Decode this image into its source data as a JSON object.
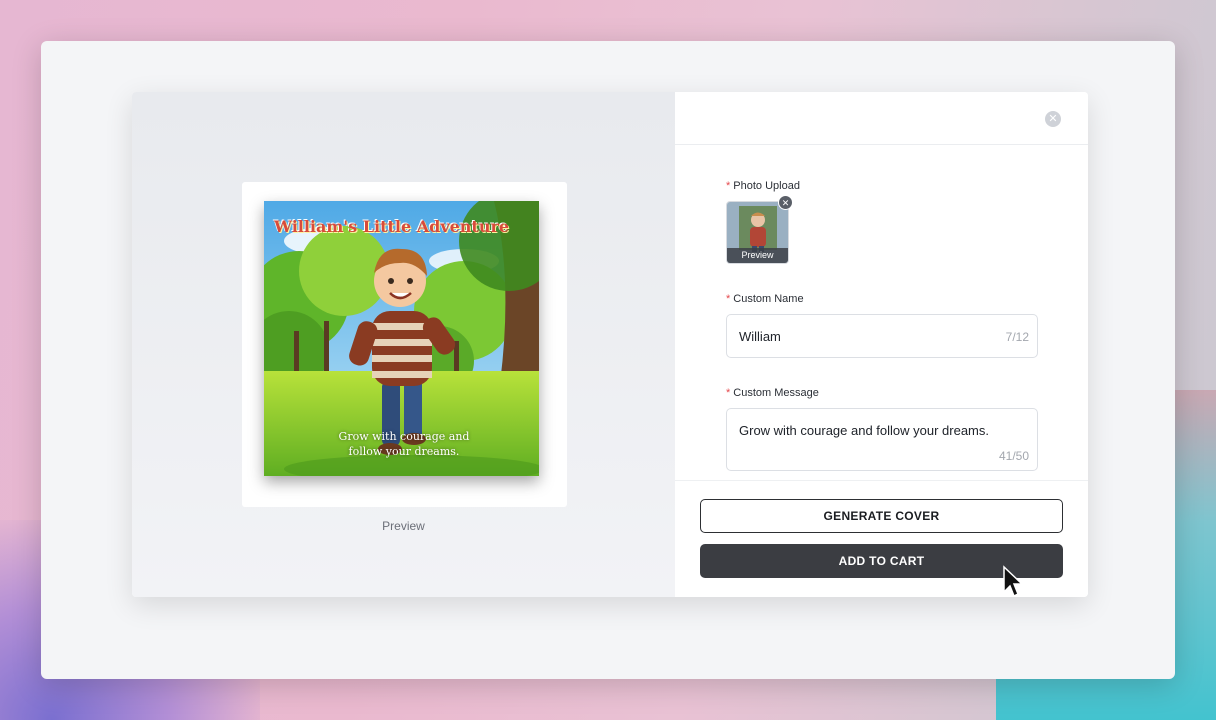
{
  "preview": {
    "cover_title": "William's Little Adventure",
    "cover_message_line1": "Grow with courage and",
    "cover_message_line2": "follow your dreams.",
    "label": "Preview"
  },
  "form": {
    "close_icon": "close-icon",
    "photo_upload": {
      "label": "Photo Upload",
      "thumb_caption": "Preview"
    },
    "custom_name": {
      "label": "Custom Name",
      "value": "William",
      "counter": "7/12"
    },
    "custom_message": {
      "label": "Custom Message",
      "value": "Grow with courage and follow your dreams.",
      "counter": "41/50"
    },
    "required_mark": "*",
    "generate_button": "GENERATE COVER",
    "add_to_cart_button": "ADD TO CART"
  },
  "colors": {
    "required": "#e5484d",
    "primary_dark": "#3b3d42",
    "cover_title": "#d84b3b"
  }
}
